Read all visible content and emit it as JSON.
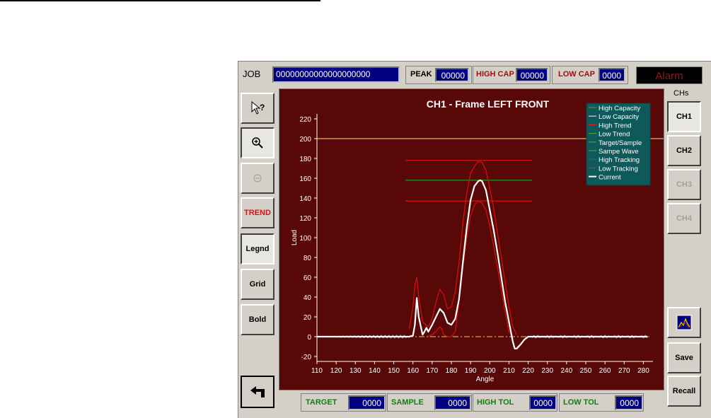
{
  "header": {
    "job_label": "JOB",
    "job_value": "00000000000000000000",
    "peak_label": "PEAK",
    "peak_value": "00000",
    "high_cap_label": "HIGH CAP",
    "high_cap_value": "00000",
    "low_cap_label": "LOW CAP",
    "low_cap_value": "0000",
    "alarm_label": "Alarm"
  },
  "left_toolbar": {
    "help_icon": "pointer-help-icon",
    "zoom_in_icon": "zoom-in-icon",
    "zoom_out_icon": "zoom-out-icon",
    "trend_label": "TREND",
    "legend_label": "Legnd",
    "grid_label": "Grid",
    "bold_label": "Bold",
    "back_icon": "undo-arrow-icon"
  },
  "right_panel": {
    "channels_label": "CHs",
    "channels": [
      "CH1",
      "CH2",
      "CH3",
      "CH4"
    ],
    "chart_icon": "chart-icon",
    "save_label": "Save",
    "recall_label": "Recall"
  },
  "footer": {
    "target_label": "TARGET",
    "target_value": "0000",
    "sample_label": "SAMPLE",
    "sample_value": "0000",
    "high_tol_label": "HIGH TOL",
    "high_tol_value": "0000",
    "low_tol_label": "LOW TOL",
    "low_tol_value": "0000"
  },
  "colors": {
    "plot_bg": "#590808",
    "panel_bg": "#d4d0c8",
    "value_box": "#000080",
    "legend_bg": "#0e5a5a",
    "high_cap_line": "#e8e870",
    "band_red": "#d01010",
    "band_green": "#1a8a1a",
    "current": "#ffffff"
  },
  "chart_data": {
    "type": "line",
    "title": "CH1 - Frame LEFT FRONT",
    "xlabel": "Angle",
    "ylabel": "Load",
    "xlim": [
      110,
      285
    ],
    "ylim": [
      -25,
      225
    ],
    "xticks": [
      110,
      120,
      130,
      140,
      150,
      160,
      170,
      180,
      190,
      200,
      210,
      220,
      230,
      240,
      250,
      260,
      270,
      280
    ],
    "yticks": [
      -20,
      0,
      20,
      40,
      60,
      80,
      100,
      120,
      140,
      160,
      180,
      200,
      220
    ],
    "grid": false,
    "legend_position": "top-right",
    "legend": [
      {
        "name": "High Capacity",
        "color": "#3fa03f"
      },
      {
        "name": "Low Capacity",
        "color": "#d8d8d8"
      },
      {
        "name": "High Trend",
        "color": "#e02020"
      },
      {
        "name": "Low Trend",
        "color": "#3fa03f"
      },
      {
        "name": "Target/Sample",
        "color": "#3fa03f"
      },
      {
        "name": "Sampe Wave",
        "color": "#3fa03f"
      },
      {
        "name": "High Tracking",
        "color": "#1f6f6f"
      },
      {
        "name": "Low Tracking",
        "color": "#e02020"
      },
      {
        "name": "Current",
        "color": "#ffffff"
      }
    ],
    "high_capacity_line": 200,
    "horizontal_bands": [
      {
        "y": 178,
        "x": [
          156,
          222
        ],
        "color": "#d01010"
      },
      {
        "y": 158,
        "x": [
          156,
          222
        ],
        "color": "#1a8a1a"
      },
      {
        "y": 137,
        "x": [
          156,
          222
        ],
        "color": "#d01010"
      }
    ],
    "series": [
      {
        "name": "Current",
        "color": "#ffffff",
        "x": [
          110,
          120,
          130,
          140,
          150,
          155,
          158,
          160,
          161,
          162,
          163,
          165,
          166,
          167,
          168,
          170,
          172,
          174,
          176,
          178,
          180,
          182,
          184,
          186,
          188,
          190,
          192,
          194,
          195,
          196,
          198,
          200,
          202,
          204,
          206,
          208,
          210,
          212,
          213,
          214,
          216,
          218,
          220,
          225,
          230,
          240,
          250,
          260,
          270,
          282
        ],
        "y": [
          0,
          0,
          0,
          0,
          0,
          0,
          0,
          1,
          12,
          39,
          20,
          2,
          5,
          9,
          5,
          12,
          20,
          28,
          24,
          14,
          12,
          18,
          38,
          75,
          110,
          138,
          152,
          157,
          158,
          157,
          148,
          128,
          108,
          85,
          60,
          35,
          15,
          -5,
          -12,
          -12,
          -8,
          -3,
          0,
          0,
          0,
          0,
          0,
          0,
          0,
          0
        ]
      },
      {
        "name": "High Tracking",
        "color": "#d01010",
        "x": [
          158,
          160,
          161,
          162,
          163,
          165,
          168,
          170,
          172,
          174,
          176,
          178,
          180,
          182,
          184,
          186,
          188,
          190,
          192,
          194,
          196,
          198,
          200,
          202,
          204,
          206,
          208,
          210,
          212,
          214
        ],
        "y": [
          8,
          30,
          52,
          60,
          40,
          15,
          10,
          18,
          35,
          48,
          42,
          28,
          30,
          45,
          75,
          115,
          145,
          165,
          172,
          177,
          176,
          168,
          150,
          130,
          105,
          80,
          55,
          30,
          10,
          2
        ]
      },
      {
        "name": "Low Tracking",
        "color": "#d01010",
        "x": [
          168,
          170,
          172,
          174,
          175,
          176,
          178,
          180,
          182,
          184,
          186,
          188,
          190,
          192,
          194,
          196,
          198,
          200,
          202,
          204,
          206,
          208,
          210,
          212
        ],
        "y": [
          0,
          2,
          5,
          10,
          8,
          2,
          0,
          0,
          5,
          35,
          70,
          100,
          122,
          133,
          137,
          135,
          128,
          112,
          92,
          70,
          48,
          25,
          5,
          0
        ]
      }
    ]
  }
}
